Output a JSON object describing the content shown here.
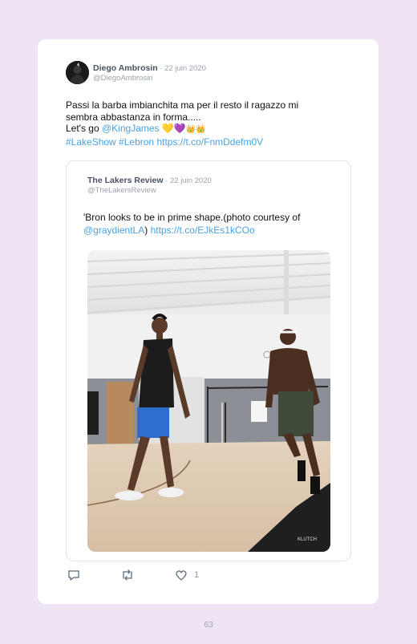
{
  "tweet": {
    "author_name": "Diego Ambrosin",
    "date": " · 22 juin 2020",
    "handle": "@DiegoAmbrosin",
    "line1": "Passi la barba imbianchita ma per il resto il ragazzo mi",
    "line2": "sembra abbastanza in forma.....",
    "line3_prefix": "Let's go ",
    "mention": "@KingJames",
    "emoji_heart_yellow": "💛",
    "emoji_heart_purple": "💜",
    "emoji_crowns": "👑👑",
    "hashtags": "#LakeShow #Lebron",
    "link": "https://t.co/FnmDdefm0V"
  },
  "quoted": {
    "author_name": "The Lakers Review",
    "date": " · 22 juin 2020",
    "handle": "@TheLakersReview",
    "line1": "'Bron looks to be in prime shape.(photo courtesy of",
    "mention": "@graydientLA",
    "paren": ") ",
    "link": "https://t.co/EJkEs1kCOo",
    "watermark": "KLUTCH"
  },
  "actions": {
    "like_count": "1"
  },
  "page_number": "63"
}
